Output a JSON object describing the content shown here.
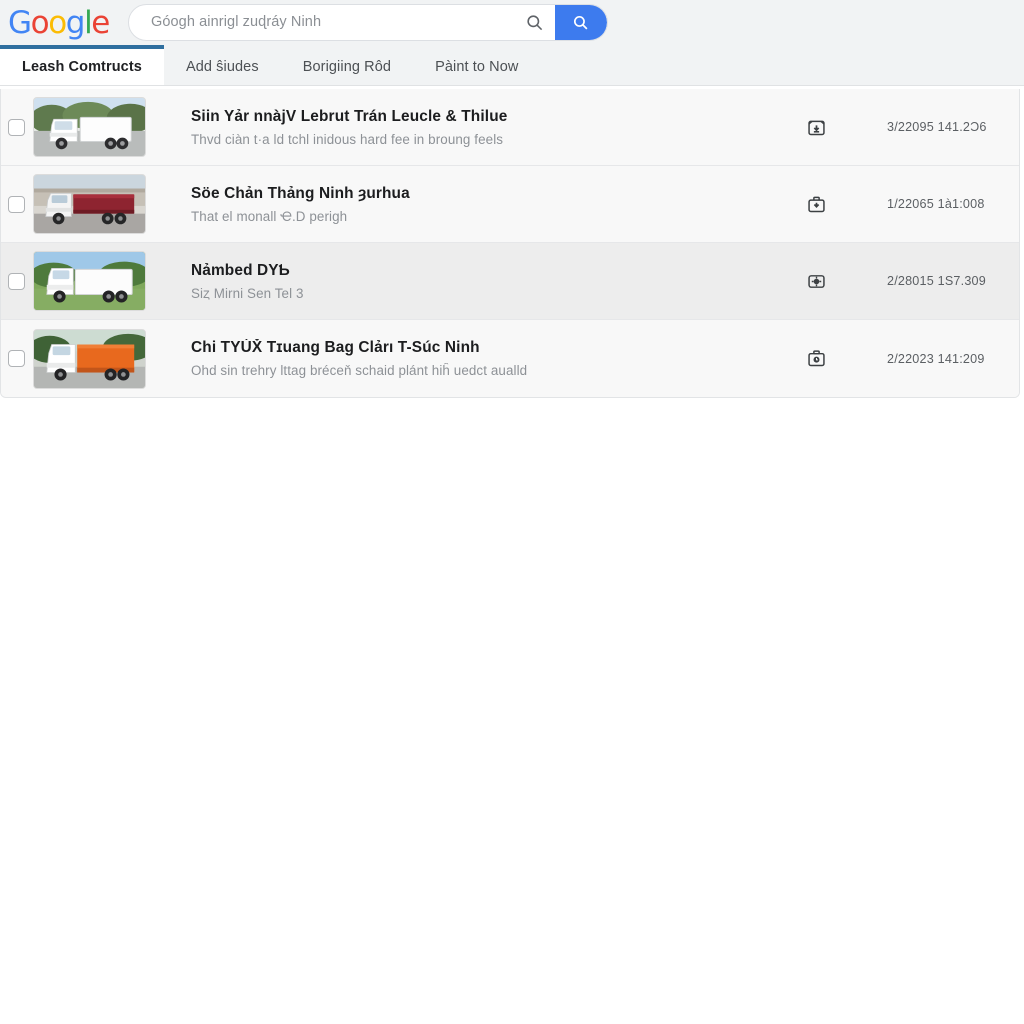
{
  "header": {
    "logo_text": "Google",
    "logo_colors": [
      "#4285F4",
      "#EA4335",
      "#FBBC05",
      "#4285F4",
      "#34A853",
      "#EA4335"
    ],
    "search": {
      "value": "Góogh ainrigl zuɖráy Ninh",
      "placeholder": "Góogh ainrigl zuɖráy Ninh",
      "inner_icon": "search-icon",
      "button_icon": "search-icon",
      "button_color": "#3d7bee"
    }
  },
  "tabs": [
    {
      "label": "Leash Comtructs",
      "active": true
    },
    {
      "label": "Add ŝiudes",
      "active": false
    },
    {
      "label": "Borigiing Rôd",
      "active": false
    },
    {
      "label": "Pàint to Now",
      "active": false
    }
  ],
  "rows": [
    {
      "checked": false,
      "thumbnail": "white-box-truck-thumbnail",
      "title": "Siin Yảr nnàjV Lebrut Trán Leucle & Thilue",
      "subtitle": "Thvd ciàn t·a ld tchl inidous hard fee in broung feels",
      "icon": "archive-down-icon",
      "date": "3/22095 141.2Ɔ6",
      "alt": false
    },
    {
      "checked": false,
      "thumbnail": "red-flatbed-truck-thumbnail",
      "title": "Söe Chản Thảng Ninh ȝurhua",
      "subtitle": "That el monall Ҽ.D perigh",
      "icon": "briefcase-icon",
      "date": "1/22065 1à1:008",
      "alt": false
    },
    {
      "checked": false,
      "thumbnail": "white-trailer-truck-thumbnail",
      "title": "Nảmbed DYƄ",
      "subtitle": "Siȥ Mirni Sen Tel 3",
      "icon": "target-circle-icon",
      "date": "2/28015 1S7.309",
      "alt": true
    },
    {
      "checked": false,
      "thumbnail": "orange-container-truck-thumbnail",
      "title": "Chi TYÙX̌ Tɪuang Bag Clảrı T-Súc Ninh",
      "subtitle": "Ohd sin trehry lttag bréceň schaid plánt hiĥ uedct aualld",
      "icon": "archive-clock-icon",
      "date": "2/22023 141:209",
      "alt": false
    }
  ]
}
